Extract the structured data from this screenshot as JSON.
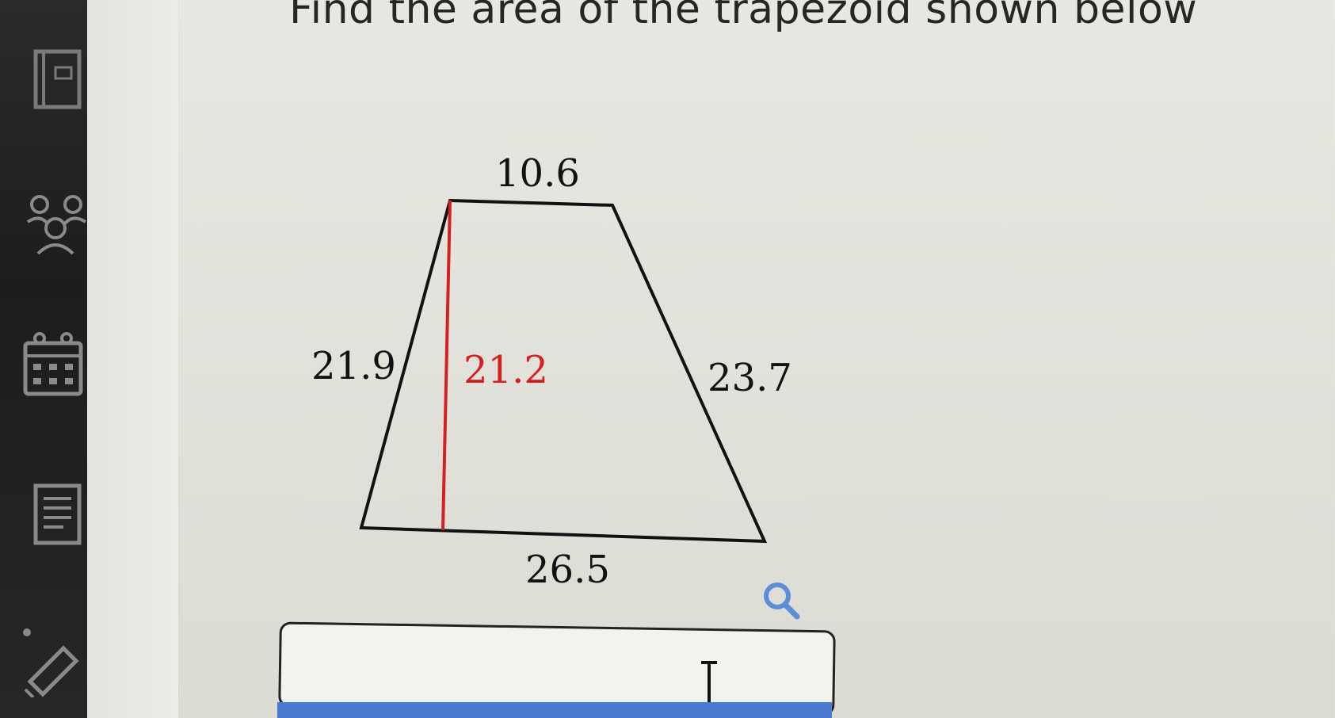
{
  "question": {
    "text": "Find the area of the trapezoid shown below"
  },
  "figure": {
    "top_base": "10.6",
    "bottom_base": "26.5",
    "left_side": "21.9",
    "right_side": "23.7",
    "height": "21.2",
    "height_color": "#d42020",
    "line_color": "#111111"
  },
  "answer": {
    "value": "",
    "placeholder": ""
  },
  "icons": {
    "zoom": "magnifier-icon",
    "sidebar": [
      "book-icon",
      "group-icon",
      "calendar-icon",
      "document-icon",
      "pencil-icon"
    ]
  },
  "colors": {
    "accent": "#4a7bd0",
    "zoom_icon": "#5a8fd8"
  }
}
